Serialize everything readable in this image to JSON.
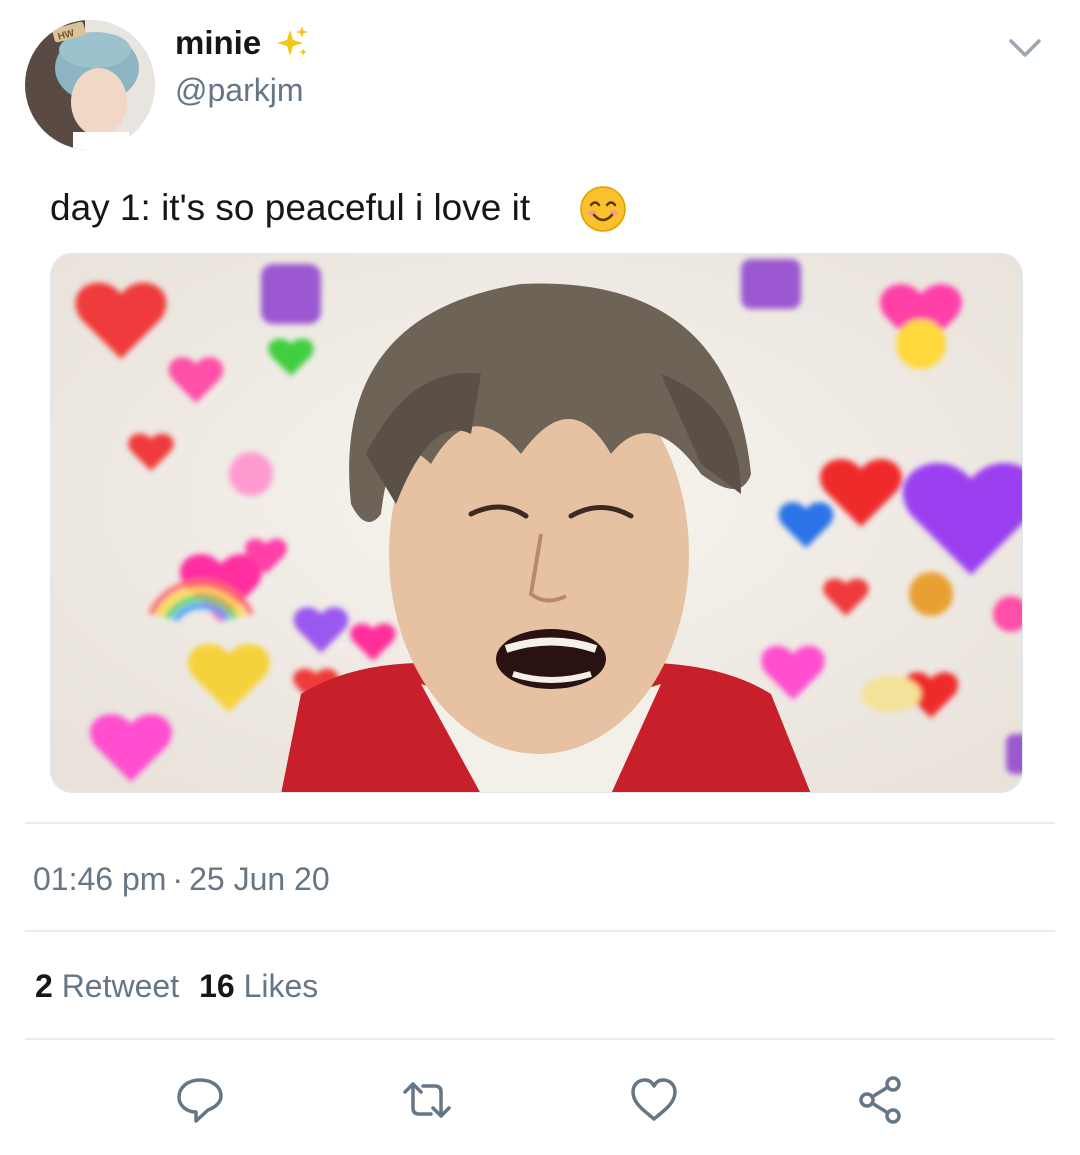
{
  "user": {
    "display_name": "minie",
    "handle": "@parkjm",
    "avatar_badge": "HW"
  },
  "tweet": {
    "text": "day 1: it's so peaceful i love it",
    "time": "01:46 pm",
    "separator": "·",
    "date": "25 Jun 20"
  },
  "stats": {
    "retweets_count": "2",
    "retweets_label": "Retweet",
    "likes_count": "16",
    "likes_label": "Likes"
  },
  "icons": {
    "sparkle": "sparkles-icon",
    "caret": "chevron-down-icon",
    "emoji": "smiling-face-icon",
    "reply": "reply-icon",
    "retweet": "retweet-icon",
    "like": "heart-icon",
    "share": "share-icon"
  },
  "colors": {
    "text": "#14171a",
    "secondary": "#657786",
    "divider": "#e6ecf0",
    "icon": "#657786"
  }
}
